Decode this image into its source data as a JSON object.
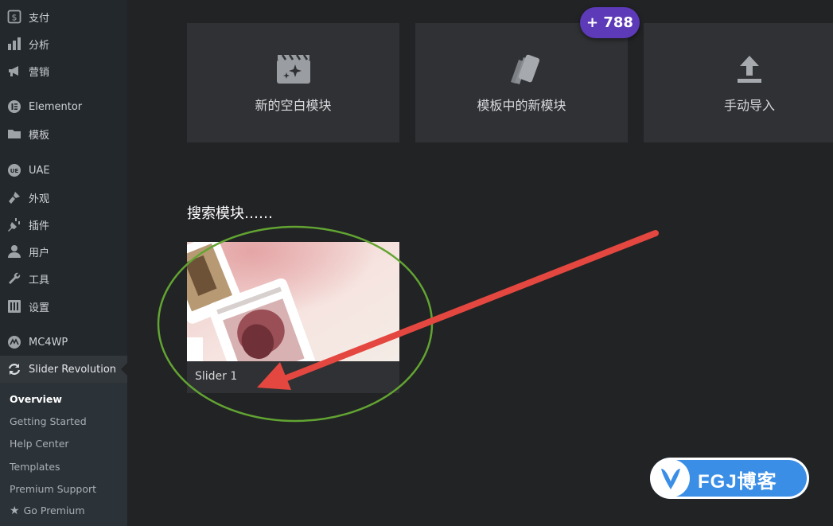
{
  "sidebar": {
    "items": [
      {
        "label": "支付",
        "icon": "payment-icon"
      },
      {
        "label": "分析",
        "icon": "analytics-icon"
      },
      {
        "label": "营销",
        "icon": "megaphone-icon"
      },
      {
        "label": "Elementor",
        "icon": "elementor-icon"
      },
      {
        "label": "模板",
        "icon": "folder-icon"
      },
      {
        "label": "UAE",
        "icon": "uae-icon"
      },
      {
        "label": "外观",
        "icon": "brush-icon"
      },
      {
        "label": "插件",
        "icon": "plugin-icon"
      },
      {
        "label": "用户",
        "icon": "user-icon"
      },
      {
        "label": "工具",
        "icon": "wrench-icon"
      },
      {
        "label": "设置",
        "icon": "settings-icon"
      },
      {
        "label": "MC4WP",
        "icon": "mc4wp-icon"
      },
      {
        "label": "Slider Revolution",
        "icon": "refresh-icon"
      }
    ],
    "submenu": [
      {
        "label": "Overview"
      },
      {
        "label": "Getting Started"
      },
      {
        "label": "Help Center"
      },
      {
        "label": "Templates"
      },
      {
        "label": "Premium Support"
      },
      {
        "label": "Go Premium"
      }
    ]
  },
  "cards": {
    "blank": {
      "label": "新的空白模块",
      "icon": "sparkle-clapboard-icon"
    },
    "template": {
      "label": "模板中的新模块",
      "icon": "template-stack-icon"
    },
    "import": {
      "label": "手动导入",
      "icon": "upload-icon"
    },
    "badge": "+ 788"
  },
  "search": {
    "title": "搜索模块……"
  },
  "modules": [
    {
      "name": "Slider 1"
    }
  ],
  "annotation": {
    "ellipse_color": "#62a432",
    "arrow_color": "#e4473f"
  },
  "watermark": {
    "text": "FGJ博客",
    "color": "#3a8ee6"
  }
}
